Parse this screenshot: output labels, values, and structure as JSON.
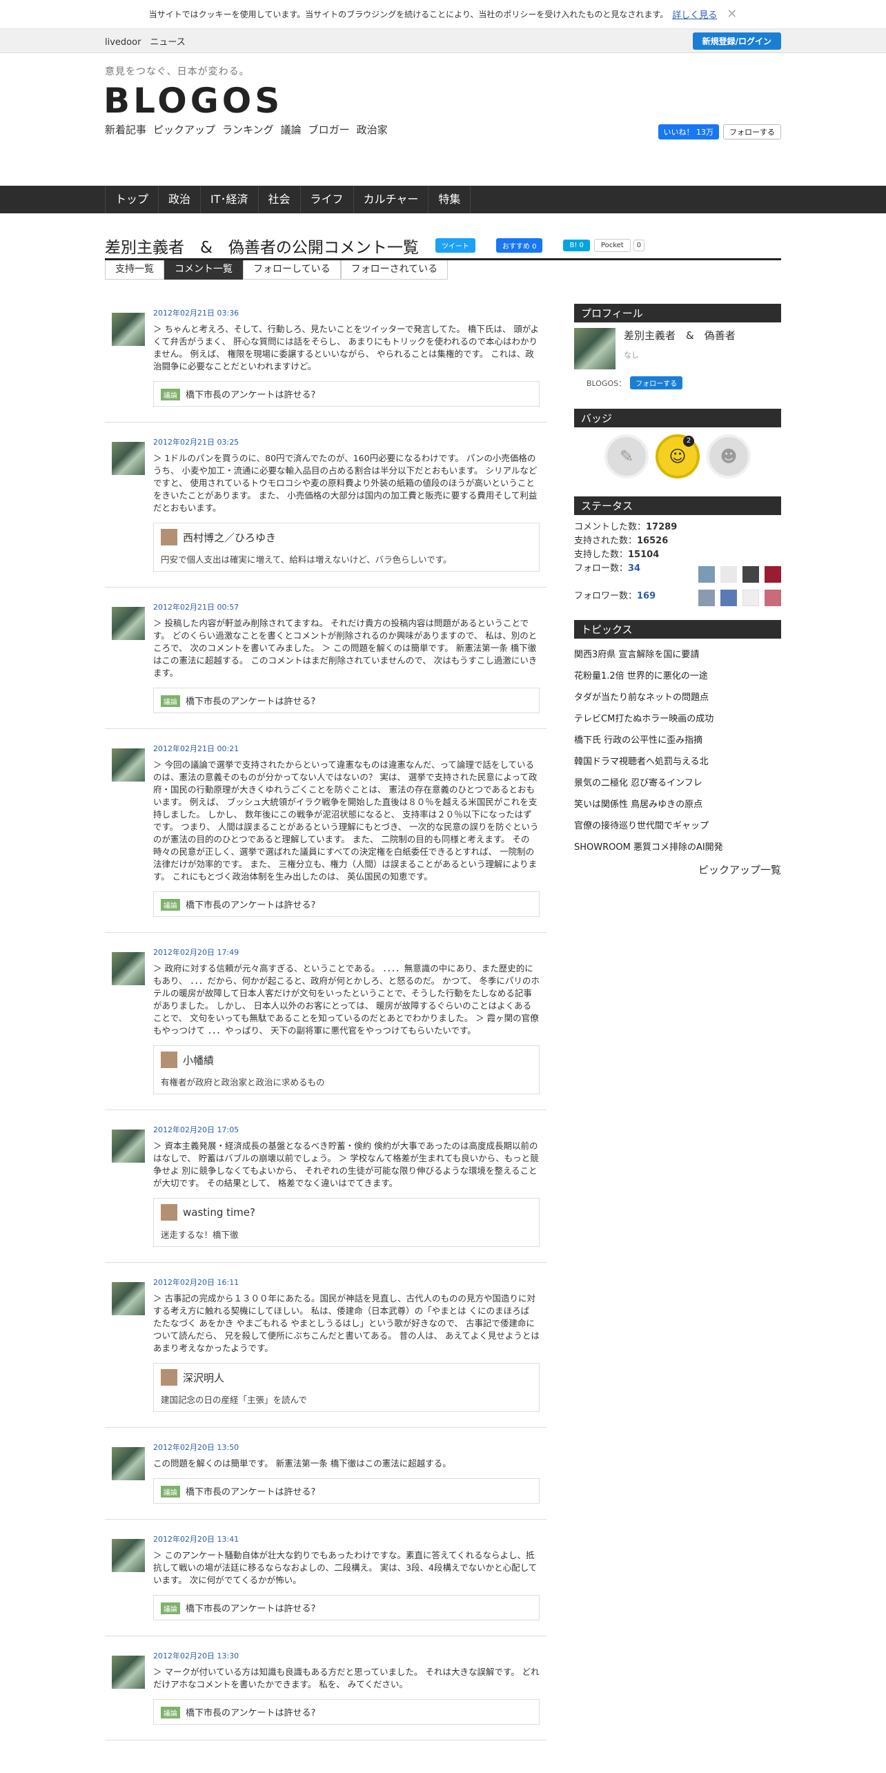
{
  "cookie": {
    "text": "当サイトではクッキーを使用しています。当サイトのブラウジングを続けることにより、当社のポリシーを受け入れたものと見なされます。",
    "link": "詳しく見る",
    "close": "✕"
  },
  "topbar": {
    "site": "livedoor　ニュース",
    "register": "新規登録/ログイン"
  },
  "header": {
    "tagline": "意見をつなぐ、日本が変わる。",
    "logo": "BLOGOS",
    "nav": [
      "新着記事",
      "ピックアップ",
      "ランキング",
      "議論",
      "ブロガー",
      "政治家"
    ],
    "fb_like": "いいね！ 13万",
    "tw_follow": "フォローする"
  },
  "gnav": [
    "トップ",
    "政治",
    "IT･経済",
    "社会",
    "ライフ",
    "カルチャー",
    "特集"
  ],
  "page": {
    "title": "差別主義者　&　偽善者の公開コメント一覧",
    "tweet": "ツイート",
    "fb_rec": "おすすめ 0",
    "hatena": "B! 0",
    "pocket": "Pocket",
    "pocket_count": "0"
  },
  "tabs": [
    "支持一覧",
    "コメント一覧",
    "フォローしている",
    "フォローされている"
  ],
  "comments": [
    {
      "date": "2012年02月21日 03:36",
      "body": "＞ ちゃんと考えろ、そして、行動しろ、見たいことをツイッターで発言してた。 橋下氏は、 頭がよくて弁舌がうまく、 肝心な質問には話をそらし、 あまりにもトリックを使われるので本心はわかりません。 例えば、 権限を現場に委譲するといいながら、 やられることは集権的です。 これは、政治闘争に必要なことだといわれますけど。",
      "ref_type": "議論",
      "ref_title": "橋下市長のアンケートは許せる?",
      "ref_user": "",
      "ref_text": ""
    },
    {
      "date": "2012年02月21日 03:25",
      "body": "＞ 1ドルのパンを買うのに、80円で済んでたのが、160円必要になるわけです。 パンの小売価格のうち、 小麦や加工・流通に必要な輸入品目の占める割合は半分以下だとおもいます。 シリアルなどですと、 使用されているトウモロコシや麦の原料費より外装の紙箱の値段のほうが高いということをきいたことがあります。 また、 小売価格の大部分は国内の加工費と販売に要する費用そして利益だとおもいます。",
      "ref_type": "",
      "ref_title": "",
      "ref_user": "西村博之／ひろゆき",
      "ref_text": "円安で個人支出は確実に増えて、給料は増えないけど、バラ色らしいです。"
    },
    {
      "date": "2012年02月21日 00:57",
      "body": "＞ 投稿した内容が軒並み削除されてますね。 それだけ貴方の投稿内容は問題があるということです。 どのくらい過激なことを書くとコメントが削除されるのか興味がありますので、 私は、別のところで、 次のコメントを書いてみました。 ＞ この問題を解くのは簡単です。 新憲法第一条 橋下徹はこの憲法に超越する。 このコメントはまだ削除されていませんので、 次はもうすこし過激にいきます。",
      "ref_type": "議論",
      "ref_title": "橋下市長のアンケートは許せる?",
      "ref_user": "",
      "ref_text": ""
    },
    {
      "date": "2012年02月21日 00:21",
      "body": "＞ 今回の議論で選挙で支持されたからといって違憲なものは違憲なんだ、って論理で話をしているのは、憲法の意義そのものが分かってない人ではないの？ 実は、 選挙で支持された民意によって政府・国民の行動原理が大きくゆれうごくことを防ぐことは、 憲法の存在意義のひとつであるとおもいます。 例えば、 ブッシュ大統領がイラク戦争を開始した直後は８０％を越える米国民がこれを支持しました。 しかし、 数年後にこの戦争が泥沼状態になると、 支持率は２０％以下になったはずです。 つまり、 人間は誤まることがあるという理解にもとづき、 一次的な民意の誤りを防ぐというのが憲法の目的のひとつであると理解しています。 また、 二院制の目的も同様と考えます。 その時々の民意が正しく、選挙で選ばれた議員にすべての決定権を白紙委任できるとすれば、 一院制の法律だけが効率的です。 また、 三権分立も、権力（人間）は誤まることがあるという理解によります。 これにもとづく政治体制を生み出したのは、 英仏国民の知恵です。",
      "ref_type": "議論",
      "ref_title": "橋下市長のアンケートは許せる?",
      "ref_user": "",
      "ref_text": ""
    },
    {
      "date": "2012年02月20日 17:49",
      "body": "＞ 政府に対する信頼が元々高すぎる、ということである。 ．．．．無意識の中にあり、また歴史的にもあり、 ．．．だから、何かが起こると、政府が何とかしろ、と怒るのだ。 かつて、 冬季にパリのホテルの暖房が故障して日本人客だけが文句をいったということで、そうした行動をたしなめる記事がありました。 しかし、 日本人以外のお客にとっては、 暖房が故障するぐらいのことはよくあることで、 文句をいっても無駄であることを知っているのだとあとでわかりました。 ＞ 霞ヶ関の官僚もやっつけて ．．．やっぱり、 天下の副将軍に悪代官をやっつけてもらいたいです。",
      "ref_type": "",
      "ref_title": "",
      "ref_user": "小幡績",
      "ref_text": "有権者が政府と政治家と政治に求めるもの"
    },
    {
      "date": "2012年02月20日 17:05",
      "body": "＞ 資本主義発展・経済成長の基盤となるべき貯蓄・倹約 倹約が大事であったのは高度成長期以前のはなしで、 貯蓄はバブルの崩壊以前でしょう。 ＞ 学校なんて格差が生まれても良いから、もっと競争せよ 別に競争しなくてもよいから、 それぞれの生徒が可能な限り伸びるような環境を整えることが大切です。 その結果として、 格差でなく違いはでてきます。",
      "ref_type": "",
      "ref_title": "",
      "ref_user": "wasting time?",
      "ref_text": "迷走するな！橋下徹"
    },
    {
      "date": "2012年02月20日 16:11",
      "body": "＞ 古事記の完成から１３００年にあたる。国民が神話を見直し、古代人のものの見方や国造りに対する考え方に触れる契機にしてほしい。 私は、倭建命（日本武尊）の「やまとは くにのまほろば たたなづく あをかき やまごもれる やまとしうるはし」という歌が好きなので、 古事記で倭建命について読んだら、 兄を殺して便所にぶちこんだと書いてある。 昔の人は、 あえてよく見せようとはあまり考えなかったようです。",
      "ref_type": "",
      "ref_title": "",
      "ref_user": "深沢明人",
      "ref_text": "建国記念の日の産経「主張」を読んで"
    },
    {
      "date": "2012年02月20日 13:50",
      "body": "この問題を解くのは簡単です。 新憲法第一条 橋下徹はこの憲法に超越する。",
      "ref_type": "議論",
      "ref_title": "橋下市長のアンケートは許せる?",
      "ref_user": "",
      "ref_text": ""
    },
    {
      "date": "2012年02月20日 13:41",
      "body": "＞ このアンケート騒動自体が壮大な釣りでもあったわけですな。素直に答えてくれるならよし、抵抗して戦いの場が法廷に移るならなおよしの、二段構え。 実は、3段、4段構えでないかと心配しています。 次に何がでてくるかが怖い。",
      "ref_type": "議論",
      "ref_title": "橋下市長のアンケートは許せる?",
      "ref_user": "",
      "ref_text": ""
    },
    {
      "date": "2012年02月20日 13:30",
      "body": "＞ マークが付いている方は知識も良識もある方だと思っていました。 それは大きな誤解です。 どれだけアホなコメントを書いたかできます。 私を、 みてください。",
      "ref_type": "議論",
      "ref_title": "橋下市長のアンケートは許せる?",
      "ref_user": "",
      "ref_text": ""
    }
  ],
  "sidebar": {
    "profile_h": "プロフィール",
    "name": "差別主義者　&　偽善者",
    "none": "なし",
    "blogos_label": "BLOGOS：",
    "follow": "フォローする",
    "badge_h": "バッジ",
    "badge_count": "2",
    "status_h": "ステータス",
    "stats": {
      "comments_label": "コメントした数：",
      "comments": "17289",
      "supported_label": "支持された数：",
      "supported": "16526",
      "support_label": "支持した数：",
      "support": "15104",
      "follow_label": "フォロー数：",
      "follow": "34",
      "follower_label": "フォロワー数：",
      "follower": "169"
    },
    "topics_h": "トピックス",
    "topics": [
      "関西3府県 宣言解除を国に要請",
      "花粉量1.2倍 世界的に悪化の一途",
      "タダが当たり前なネットの問題点",
      "テレビCM打たぬホラー映画の成功",
      "橋下氏 行政の公平性に歪み指摘",
      "韓国ドラマ視聴者へ処罰与える北",
      "景気の二極化 忍び寄るインフレ",
      "笑いは関係性 鳥居みゆきの原点",
      "官僚の接待巡り世代間でギャップ",
      "SHOWROOM 悪質コメ排除のAI開発"
    ],
    "more": "ピックアップ一覧"
  }
}
